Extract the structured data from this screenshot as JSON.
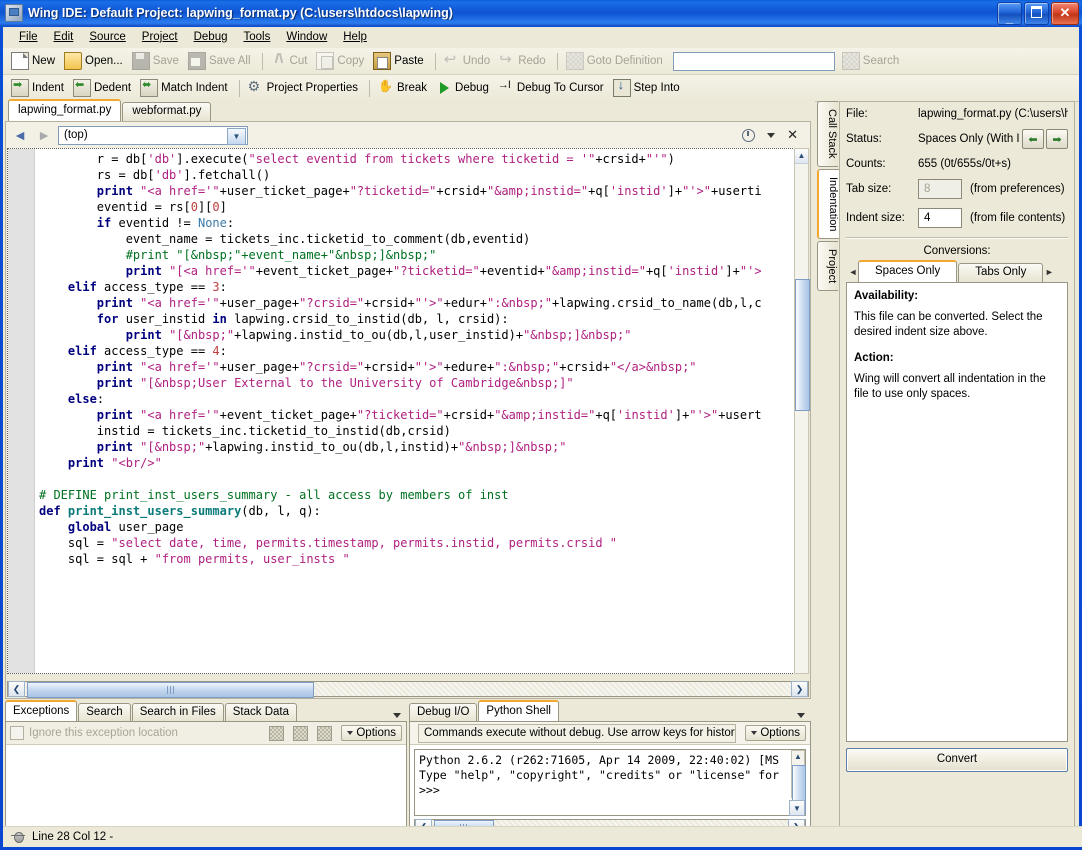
{
  "window": {
    "title": "Wing IDE: Default Project: lapwing_format.py (C:\\users\\htdocs\\lapwing)",
    "minimize_label": "_",
    "maximize_label": "",
    "close_label": "✕"
  },
  "menubar": [
    {
      "label": "File"
    },
    {
      "label": "Edit"
    },
    {
      "label": "Source"
    },
    {
      "label": "Project"
    },
    {
      "label": "Debug"
    },
    {
      "label": "Tools"
    },
    {
      "label": "Window"
    },
    {
      "label": "Help"
    }
  ],
  "toolbar_row1": [
    {
      "label": "New",
      "icon": "new-file-icon",
      "enabled": true
    },
    {
      "label": "Open...",
      "icon": "open-folder-icon",
      "enabled": true
    },
    {
      "label": "Save",
      "icon": "save-icon",
      "enabled": false
    },
    {
      "label": "Save All",
      "icon": "save-all-icon",
      "enabled": false
    },
    {
      "label": "Cut",
      "icon": "scissors-icon",
      "enabled": false
    },
    {
      "label": "Copy",
      "icon": "copy-icon",
      "enabled": false
    },
    {
      "label": "Paste",
      "icon": "clipboard-paste-icon",
      "enabled": true
    },
    {
      "label": "Undo",
      "icon": "undo-arrow-icon",
      "enabled": false
    },
    {
      "label": "Redo",
      "icon": "redo-arrow-icon",
      "enabled": false
    },
    {
      "label": "Goto Definition",
      "icon": "goto-definition-icon",
      "enabled": false
    },
    {
      "label": "Search",
      "icon": "search-magnifier-icon",
      "enabled": false
    }
  ],
  "toolbar_search": {
    "value": "",
    "placeholder": ""
  },
  "toolbar_row2": [
    {
      "label": "Indent",
      "icon": "indent-right-icon"
    },
    {
      "label": "Dedent",
      "icon": "indent-left-icon"
    },
    {
      "label": "Match Indent",
      "icon": "match-indent-icon"
    },
    {
      "label": "Project Properties",
      "icon": "project-properties-icon"
    },
    {
      "label": "Break",
      "icon": "break-hand-icon"
    },
    {
      "label": "Debug",
      "icon": "debug-play-icon"
    },
    {
      "label": "Debug To Cursor",
      "icon": "debug-to-cursor-icon"
    },
    {
      "label": "Step Into",
      "icon": "step-into-icon"
    }
  ],
  "editor": {
    "tabs": [
      {
        "label": "lapwing_format.py",
        "active": true
      },
      {
        "label": "webformat.py",
        "active": false
      }
    ],
    "scope_selector": {
      "value": "(top)"
    },
    "back_label": "◄",
    "forward_label": "►",
    "close_label": "✕",
    "code_lines": [
      {
        "indent": 8,
        "tokens": [
          {
            "t": "r = db[",
            "c": "plain"
          },
          {
            "t": "'db'",
            "c": "str"
          },
          {
            "t": "].execute(",
            "c": "plain"
          },
          {
            "t": "\"select eventid from tickets where ticketid = '\"",
            "c": "str"
          },
          {
            "t": "+crsid+",
            "c": "plain"
          },
          {
            "t": "\"'\"",
            "c": "str"
          },
          {
            "t": ")",
            "c": "plain"
          }
        ]
      },
      {
        "indent": 8,
        "tokens": [
          {
            "t": "rs = db[",
            "c": "plain"
          },
          {
            "t": "'db'",
            "c": "str"
          },
          {
            "t": "].fetchall()",
            "c": "plain"
          }
        ]
      },
      {
        "indent": 8,
        "tokens": [
          {
            "t": "print ",
            "c": "kw"
          },
          {
            "t": "\"<a href='\"",
            "c": "str"
          },
          {
            "t": "+user_ticket_page+",
            "c": "plain"
          },
          {
            "t": "\"?ticketid=\"",
            "c": "str"
          },
          {
            "t": "+crsid+",
            "c": "plain"
          },
          {
            "t": "\"&amp;instid=\"",
            "c": "str"
          },
          {
            "t": "+q[",
            "c": "plain"
          },
          {
            "t": "'instid'",
            "c": "str"
          },
          {
            "t": "]+",
            "c": "plain"
          },
          {
            "t": "\"'>\"",
            "c": "str"
          },
          {
            "t": "+userti",
            "c": "plain"
          }
        ]
      },
      {
        "indent": 8,
        "tokens": [
          {
            "t": "eventid = rs[",
            "c": "plain"
          },
          {
            "t": "0",
            "c": "num"
          },
          {
            "t": "][",
            "c": "plain"
          },
          {
            "t": "0",
            "c": "num"
          },
          {
            "t": "]",
            "c": "plain"
          }
        ]
      },
      {
        "indent": 8,
        "tokens": [
          {
            "t": "if ",
            "c": "kw"
          },
          {
            "t": "eventid != ",
            "c": "plain"
          },
          {
            "t": "None",
            "c": "bi"
          },
          {
            "t": ":",
            "c": "plain"
          }
        ]
      },
      {
        "indent": 12,
        "tokens": [
          {
            "t": "event_name = tickets_inc.ticketid_to_comment(db,eventid)",
            "c": "plain"
          }
        ]
      },
      {
        "indent": 12,
        "tokens": [
          {
            "t": "#print \"[&nbsp;\"+event_name+\"&nbsp;]&nbsp;\"",
            "c": "cmt"
          }
        ]
      },
      {
        "indent": 12,
        "tokens": [
          {
            "t": "print ",
            "c": "kw"
          },
          {
            "t": "\"[<a href='\"",
            "c": "str"
          },
          {
            "t": "+event_ticket_page+",
            "c": "plain"
          },
          {
            "t": "\"?ticketid=\"",
            "c": "str"
          },
          {
            "t": "+eventid+",
            "c": "plain"
          },
          {
            "t": "\"&amp;instid=\"",
            "c": "str"
          },
          {
            "t": "+q[",
            "c": "plain"
          },
          {
            "t": "'instid'",
            "c": "str"
          },
          {
            "t": "]+",
            "c": "plain"
          },
          {
            "t": "\"'>",
            "c": "str"
          }
        ]
      },
      {
        "indent": 4,
        "tokens": [
          {
            "t": "elif ",
            "c": "kw"
          },
          {
            "t": "access_type == ",
            "c": "plain"
          },
          {
            "t": "3",
            "c": "num"
          },
          {
            "t": ":",
            "c": "plain"
          }
        ]
      },
      {
        "indent": 8,
        "tokens": [
          {
            "t": "print ",
            "c": "kw"
          },
          {
            "t": "\"<a href='\"",
            "c": "str"
          },
          {
            "t": "+user_page+",
            "c": "plain"
          },
          {
            "t": "\"?crsid=\"",
            "c": "str"
          },
          {
            "t": "+crsid+",
            "c": "plain"
          },
          {
            "t": "\"'>\"",
            "c": "str"
          },
          {
            "t": "+edur+",
            "c": "plain"
          },
          {
            "t": "\":&nbsp;\"",
            "c": "str"
          },
          {
            "t": "+lapwing.crsid_to_name(db,l,c",
            "c": "plain"
          }
        ]
      },
      {
        "indent": 8,
        "tokens": [
          {
            "t": "for ",
            "c": "kw"
          },
          {
            "t": "user_instid ",
            "c": "plain"
          },
          {
            "t": "in ",
            "c": "kw"
          },
          {
            "t": "lapwing.crsid_to_instid(db, l, crsid):",
            "c": "plain"
          }
        ]
      },
      {
        "indent": 12,
        "tokens": [
          {
            "t": "print ",
            "c": "kw"
          },
          {
            "t": "\"[&nbsp;\"",
            "c": "str"
          },
          {
            "t": "+lapwing.instid_to_ou(db,l,user_instid)+",
            "c": "plain"
          },
          {
            "t": "\"&nbsp;]&nbsp;\"",
            "c": "str"
          }
        ]
      },
      {
        "indent": 4,
        "tokens": [
          {
            "t": "elif ",
            "c": "kw"
          },
          {
            "t": "access_type == ",
            "c": "plain"
          },
          {
            "t": "4",
            "c": "num"
          },
          {
            "t": ":",
            "c": "plain"
          }
        ]
      },
      {
        "indent": 8,
        "tokens": [
          {
            "t": "print ",
            "c": "kw"
          },
          {
            "t": "\"<a href='\"",
            "c": "str"
          },
          {
            "t": "+user_page+",
            "c": "plain"
          },
          {
            "t": "\"?crsid=\"",
            "c": "str"
          },
          {
            "t": "+crsid+",
            "c": "plain"
          },
          {
            "t": "\"'>\"",
            "c": "str"
          },
          {
            "t": "+edure+",
            "c": "plain"
          },
          {
            "t": "\":&nbsp;\"",
            "c": "str"
          },
          {
            "t": "+crsid+",
            "c": "plain"
          },
          {
            "t": "\"</a>&nbsp;\"",
            "c": "str"
          }
        ]
      },
      {
        "indent": 8,
        "tokens": [
          {
            "t": "print ",
            "c": "kw"
          },
          {
            "t": "\"[&nbsp;User External to the University of Cambridge&nbsp;]\"",
            "c": "str"
          }
        ]
      },
      {
        "indent": 4,
        "tokens": [
          {
            "t": "else",
            "c": "kw"
          },
          {
            "t": ":",
            "c": "plain"
          }
        ]
      },
      {
        "indent": 8,
        "tokens": [
          {
            "t": "print ",
            "c": "kw"
          },
          {
            "t": "\"<a href='\"",
            "c": "str"
          },
          {
            "t": "+event_ticket_page+",
            "c": "plain"
          },
          {
            "t": "\"?ticketid=\"",
            "c": "str"
          },
          {
            "t": "+crsid+",
            "c": "plain"
          },
          {
            "t": "\"&amp;instid=\"",
            "c": "str"
          },
          {
            "t": "+q[",
            "c": "plain"
          },
          {
            "t": "'instid'",
            "c": "str"
          },
          {
            "t": "]+",
            "c": "plain"
          },
          {
            "t": "\"'>\"",
            "c": "str"
          },
          {
            "t": "+usert",
            "c": "plain"
          }
        ]
      },
      {
        "indent": 8,
        "tokens": [
          {
            "t": "instid = tickets_inc.ticketid_to_instid(db,crsid)",
            "c": "plain"
          }
        ]
      },
      {
        "indent": 8,
        "tokens": [
          {
            "t": "print ",
            "c": "kw"
          },
          {
            "t": "\"[&nbsp;\"",
            "c": "str"
          },
          {
            "t": "+lapwing.instid_to_ou(db,l,instid)+",
            "c": "plain"
          },
          {
            "t": "\"&nbsp;]&nbsp;\"",
            "c": "str"
          }
        ]
      },
      {
        "indent": 4,
        "tokens": [
          {
            "t": "print ",
            "c": "kw"
          },
          {
            "t": "\"<br/>\"",
            "c": "str"
          }
        ]
      },
      {
        "indent": 0,
        "tokens": []
      },
      {
        "indent": 0,
        "tokens": [
          {
            "t": "# DEFINE print_inst_users_summary - all access by members of inst",
            "c": "cmt"
          }
        ]
      },
      {
        "indent": 0,
        "tokens": [
          {
            "t": "def ",
            "c": "kw"
          },
          {
            "t": "print_inst_users_summary",
            "c": "fn"
          },
          {
            "t": "(db, l, q):",
            "c": "plain"
          }
        ]
      },
      {
        "indent": 4,
        "tokens": [
          {
            "t": "global ",
            "c": "kw"
          },
          {
            "t": "user_page",
            "c": "plain"
          }
        ]
      },
      {
        "indent": 4,
        "tokens": [
          {
            "t": "sql = ",
            "c": "plain"
          },
          {
            "t": "\"select date, time, permits.timestamp, permits.instid, permits.crsid \"",
            "c": "str"
          }
        ]
      },
      {
        "indent": 4,
        "tokens": [
          {
            "t": "sql = sql + ",
            "c": "plain"
          },
          {
            "t": "\"from permits, user_insts \"",
            "c": "str"
          }
        ]
      }
    ]
  },
  "bottom_left": {
    "tabs": [
      {
        "label": "Exceptions",
        "active": true
      },
      {
        "label": "Search",
        "active": false
      },
      {
        "label": "Search in Files",
        "active": false
      },
      {
        "label": "Stack Data",
        "active": false
      }
    ],
    "checkbox_label": "Ignore this exception location",
    "options_label": "Options"
  },
  "bottom_right": {
    "tabs": [
      {
        "label": "Debug I/O",
        "active": false
      },
      {
        "label": "Python Shell",
        "active": true
      }
    ],
    "hint": "Commands execute without debug.  Use arrow keys for history.",
    "options_label": "Options",
    "shell_lines": [
      "Python 2.6.2 (r262:71605, Apr 14 2009, 22:40:02) [MS",
      "Type \"help\", \"copyright\", \"credits\" or \"license\" for",
      ">>>"
    ]
  },
  "right_panel": {
    "vtabs": [
      {
        "label": "Call Stack",
        "active": false
      },
      {
        "label": "Indentation",
        "active": true
      },
      {
        "label": "Project",
        "active": false
      }
    ],
    "fields": [
      {
        "label": "File:",
        "value": "lapwing_format.py (C:\\users\\htd"
      },
      {
        "label": "Status:",
        "value": "Spaces Only (With Ind"
      },
      {
        "label": "Counts:",
        "value": "655 (0t/655s/0t+s)"
      }
    ],
    "prev_label": "⬅",
    "next_label": "➡",
    "tab_size": {
      "label": "Tab size:",
      "value": "8",
      "hint": "(from preferences)"
    },
    "indent_size": {
      "label": "Indent size:",
      "value": "4",
      "hint": "(from file contents)"
    },
    "conversions_label": "Conversions:",
    "conv_tabs": [
      {
        "label": "Spaces Only",
        "active": true
      },
      {
        "label": "Tabs Only",
        "active": false
      }
    ],
    "conv_scroll_left": "◄",
    "conv_scroll_right": "►",
    "availability_heading": "Availability:",
    "availability_text": "This file can be converted.  Select the desired indent size above.",
    "action_heading": "Action:",
    "action_text": "Wing will convert all indentation in the file to use only spaces.",
    "convert_button": "Convert"
  },
  "statusbar": {
    "position": "Line 28 Col 12 -",
    "icon": "bug-icon"
  }
}
